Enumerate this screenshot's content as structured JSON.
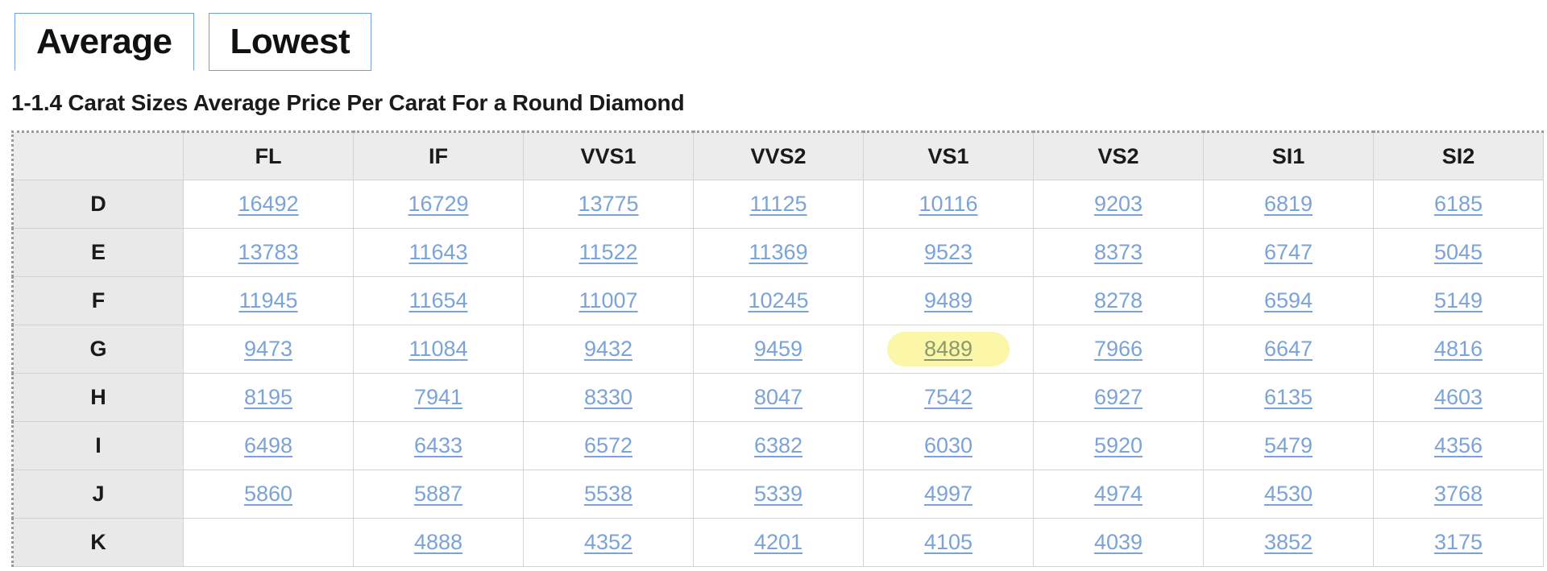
{
  "tabs": [
    {
      "label": "Average",
      "active": true
    },
    {
      "label": "Lowest",
      "active": false
    }
  ],
  "page_title": "1-1.4 Carat Sizes Average Price Per Carat For a Round Diamond",
  "colors": {
    "tab_border": "#6f9fe0",
    "link": "#7ba3d8",
    "highlight_bg": "#fbf6a8",
    "header_bg": "#ececec",
    "rowlabel_bg": "#e9e9e9",
    "grid_line": "#d3d3d3"
  },
  "table": {
    "corner_label": "",
    "columns": [
      "FL",
      "IF",
      "VVS1",
      "VVS2",
      "VS1",
      "VS2",
      "SI1",
      "SI2"
    ],
    "rows": [
      {
        "label": "D",
        "values": [
          "16492",
          "16729",
          "13775",
          "11125",
          "10116",
          "9203",
          "6819",
          "6185"
        ]
      },
      {
        "label": "E",
        "values": [
          "13783",
          "11643",
          "11522",
          "11369",
          "9523",
          "8373",
          "6747",
          "5045"
        ]
      },
      {
        "label": "F",
        "values": [
          "11945",
          "11654",
          "11007",
          "10245",
          "9489",
          "8278",
          "6594",
          "5149"
        ]
      },
      {
        "label": "G",
        "values": [
          "9473",
          "11084",
          "9432",
          "9459",
          "8489",
          "7966",
          "6647",
          "4816"
        ]
      },
      {
        "label": "H",
        "values": [
          "8195",
          "7941",
          "8330",
          "8047",
          "7542",
          "6927",
          "6135",
          "4603"
        ]
      },
      {
        "label": "I",
        "values": [
          "6498",
          "6433",
          "6572",
          "6382",
          "6030",
          "5920",
          "5479",
          "4356"
        ]
      },
      {
        "label": "J",
        "values": [
          "5860",
          "5887",
          "5538",
          "5339",
          "4997",
          "4974",
          "4530",
          "3768"
        ]
      },
      {
        "label": "K",
        "values": [
          "",
          "4888",
          "4352",
          "4201",
          "4105",
          "4039",
          "3852",
          "3175"
        ]
      }
    ],
    "highlighted_cell": {
      "row": "G",
      "column": "VS1",
      "value": "8489"
    }
  }
}
